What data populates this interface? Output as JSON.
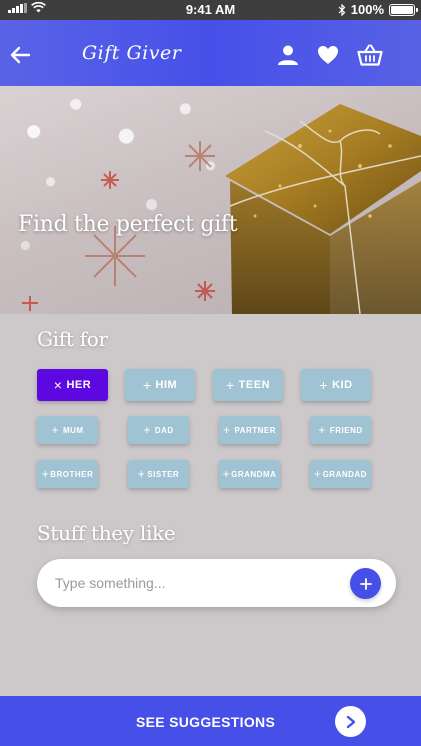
{
  "status_bar": {
    "time": "9:41 AM",
    "battery": "100%",
    "battery_level": 1.0
  },
  "app_bar": {
    "title": "Gift Giver",
    "icons": [
      "back-arrow-icon",
      "profile-icon",
      "heart-icon",
      "basket-icon"
    ]
  },
  "hero": {
    "title": "Find the perfect gift"
  },
  "gift_for": {
    "title": "Gift for",
    "primary_chips": [
      {
        "label": "HER",
        "symbol": "×",
        "selected": true
      },
      {
        "label": "HIM",
        "symbol": "+",
        "selected": false
      },
      {
        "label": "TEEN",
        "symbol": "+",
        "selected": false
      },
      {
        "label": "KID",
        "symbol": "+",
        "selected": false
      }
    ],
    "secondary_chips": [
      {
        "label": "MUM",
        "symbol": "+"
      },
      {
        "label": "DAD",
        "symbol": "+"
      },
      {
        "label": "PARTNER",
        "symbol": "+"
      },
      {
        "label": "FRIEND",
        "symbol": "+"
      },
      {
        "label": "BROTHER",
        "symbol": "+"
      },
      {
        "label": "SISTER",
        "symbol": "+"
      },
      {
        "label": "GRANDMA",
        "symbol": "+"
      },
      {
        "label": "GRANDAD",
        "symbol": "+"
      }
    ]
  },
  "likes": {
    "title": "Stuff they like",
    "placeholder": "Type something...",
    "value": ""
  },
  "cta": {
    "label": "SEE SUGGESTIONS"
  },
  "colors": {
    "primary": "#4650e9",
    "chip_selected": "#5d07e1",
    "chip": "#9fc3d2",
    "background": "#cdc8ca",
    "status_bar": "#3e3e3e"
  }
}
